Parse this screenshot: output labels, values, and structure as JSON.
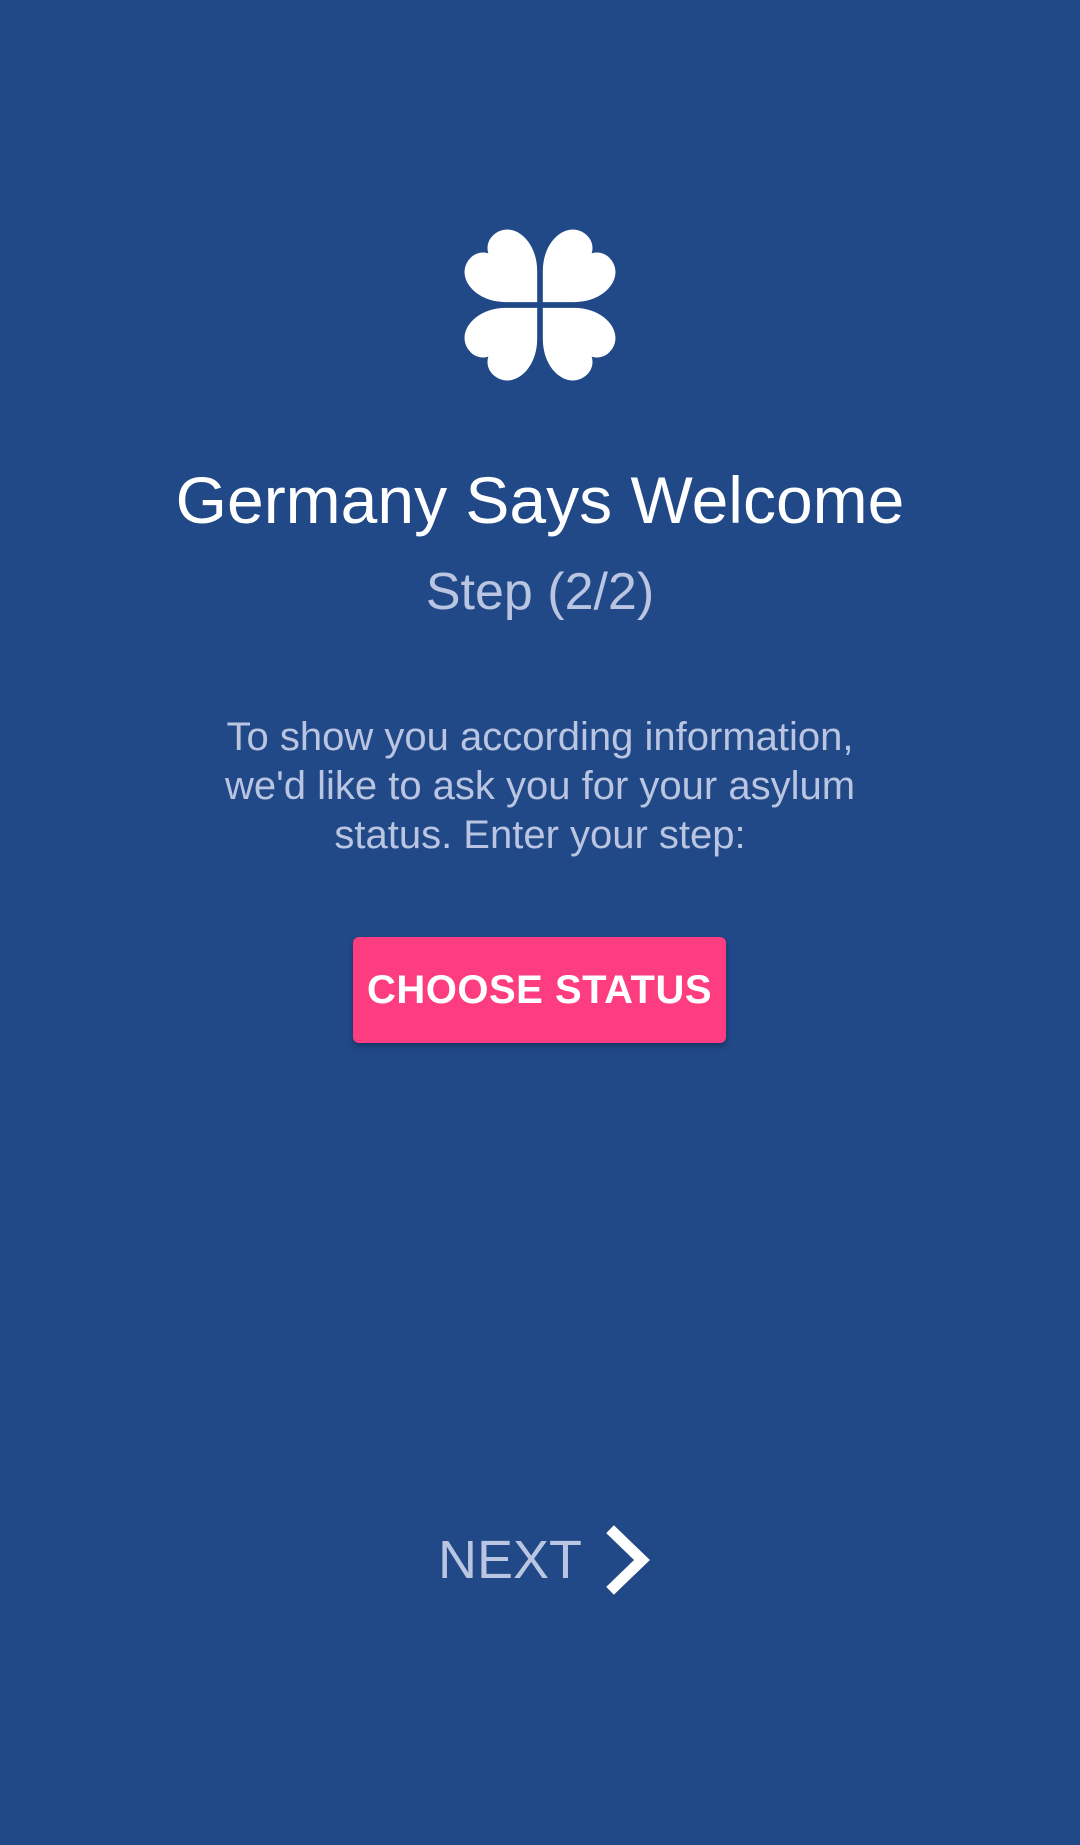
{
  "logo": {
    "icon": "four-leaf-clover-icon",
    "color": "#ffffff"
  },
  "welcome": {
    "title": "Germany Says Welcome",
    "step": "Step (2/2)",
    "description_lines": [
      "To show you according information,",
      "we'd like to ask you for your asylum",
      "status. Enter your step:"
    ]
  },
  "actions": {
    "choose_status_label": "CHOOSE STATUS",
    "next_label": "NEXT",
    "next_icon": "chevron-right-icon"
  },
  "colors": {
    "background": "#214887",
    "accent": "#fd3d80",
    "muted_text": "#b9c5e1",
    "primary_text": "#ffffff"
  }
}
